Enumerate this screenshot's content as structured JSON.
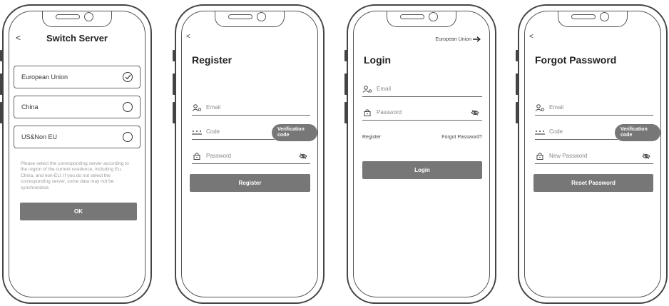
{
  "switch_server": {
    "back": "<",
    "title": "Switch Server",
    "options": [
      {
        "label": "European Union",
        "selected": true
      },
      {
        "label": "China",
        "selected": false
      },
      {
        "label": "US&Non EU",
        "selected": false
      }
    ],
    "note": "Please select the corresponding server according to the region of the current residence, including Eu, China, and non-EU. If you do not select the corresponding server, some data may not be synchronized.",
    "ok_label": "OK"
  },
  "register": {
    "back": "<",
    "title": "Register",
    "email_placeholder": "Email",
    "code_placeholder": "Code",
    "verification_label": "Verification code",
    "password_placeholder": "Password",
    "button_label": "Register"
  },
  "login": {
    "region": "European Union",
    "title": "Login",
    "email_placeholder": "Email",
    "password_placeholder": "Password",
    "register_link": "Register",
    "forgot_link": "Forgot Password?",
    "button_label": "Login"
  },
  "forgot": {
    "back": "<",
    "title": "Forgot Password",
    "email_placeholder": "Email",
    "code_placeholder": "Code",
    "verification_label": "Verification code",
    "password_placeholder": "New Password",
    "button_label": "Reset Password"
  },
  "colors": {
    "button": "#777777",
    "outline": "#444444",
    "hint": "#999999"
  }
}
